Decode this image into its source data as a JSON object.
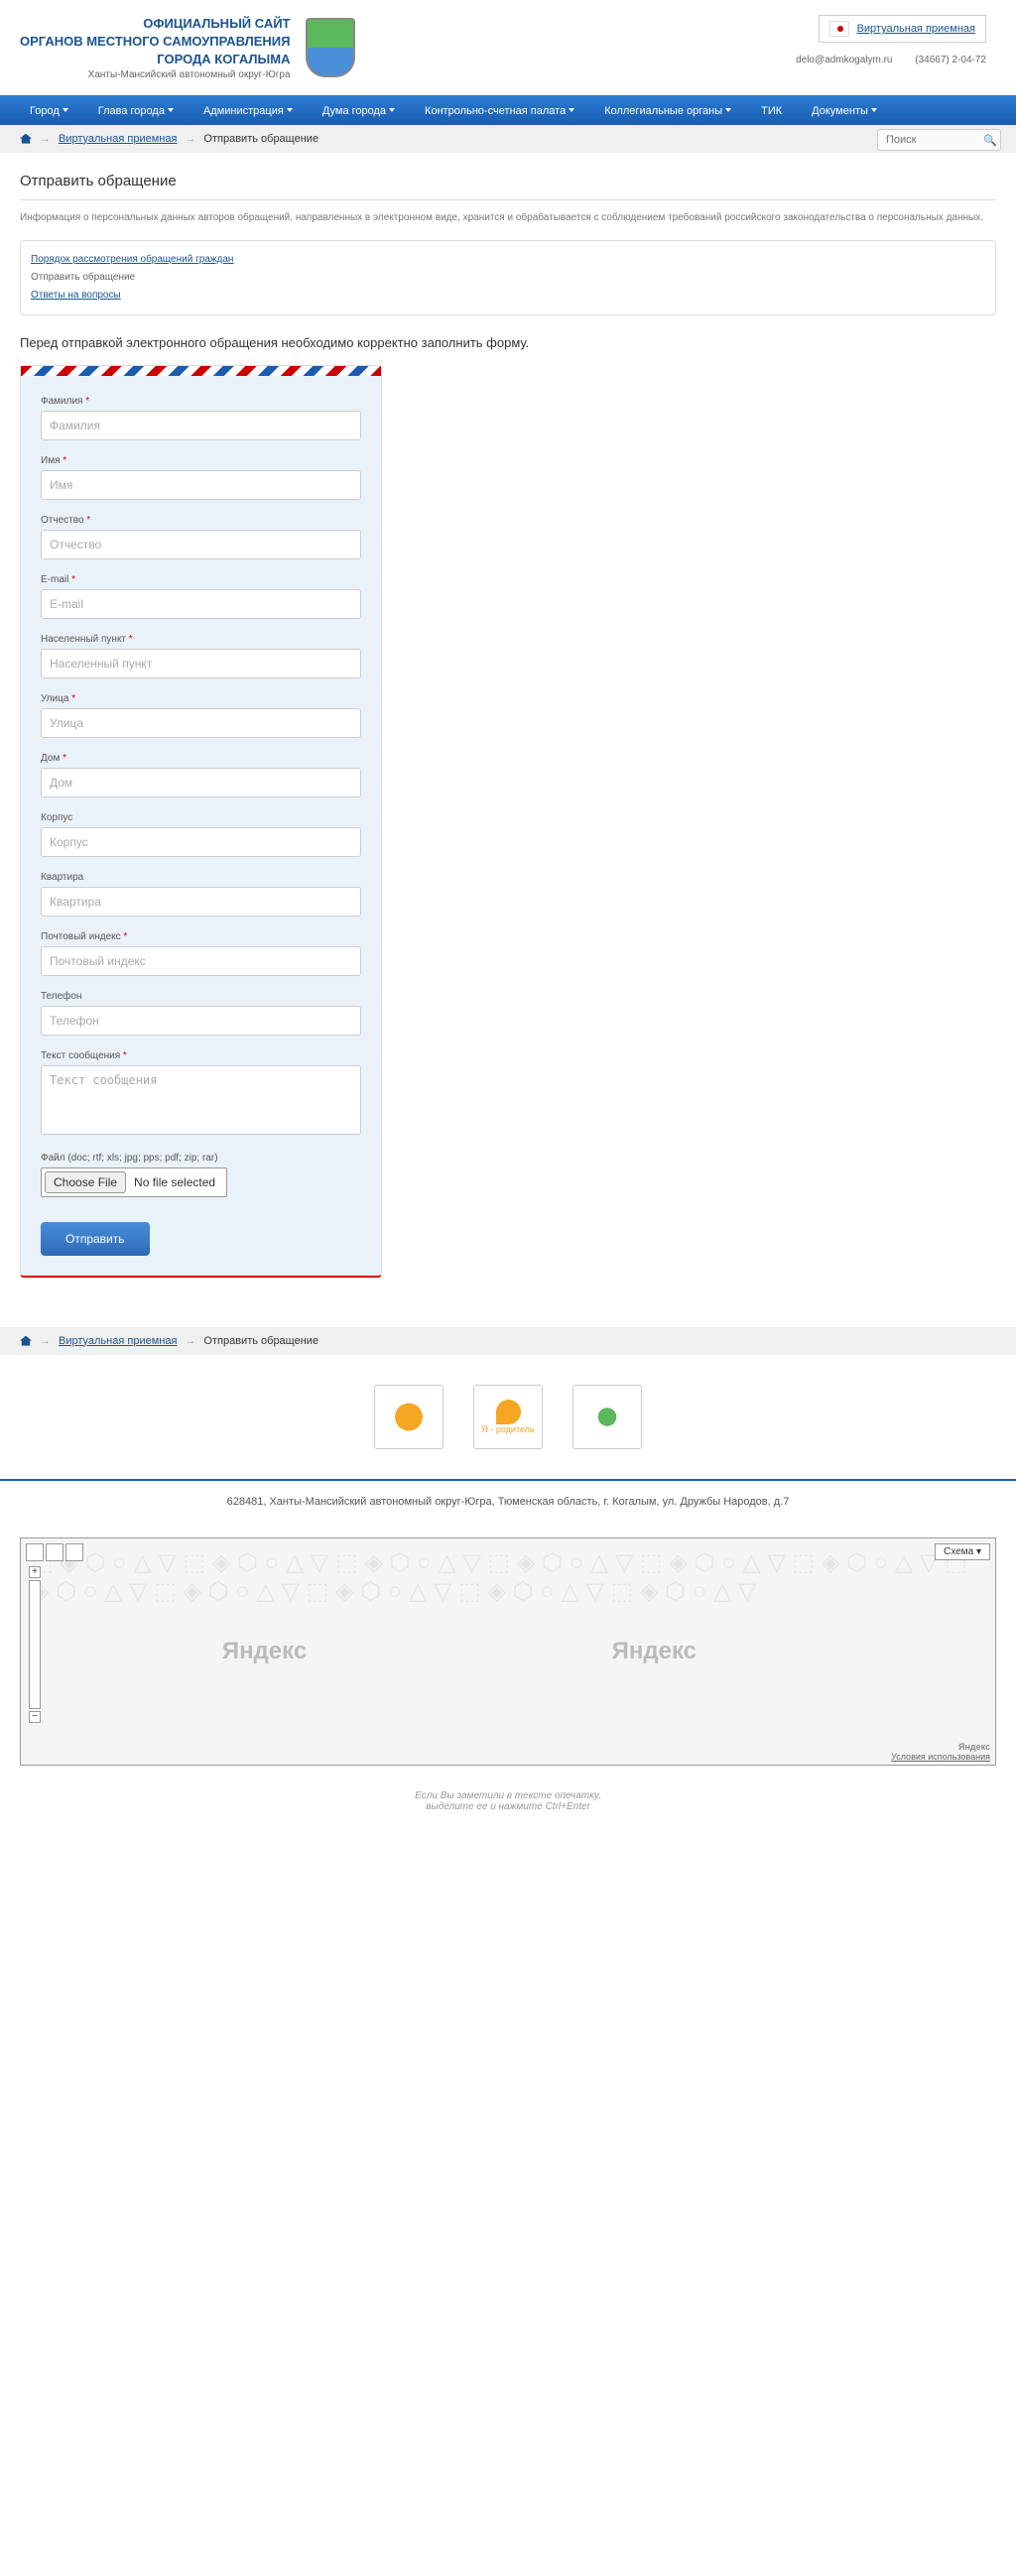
{
  "header": {
    "title_l1": "ОФИЦИАЛЬНЫЙ САЙТ",
    "title_l2": "ОРГАНОВ МЕСТНОГО САМОУПРАВЛЕНИЯ",
    "title_l3": "ГОРОДА КОГАЛЫМА",
    "subtitle": "Ханты-Мансийский автономный округ-Югра",
    "virtual_link": "Виртуальная приемная",
    "email": "delo@admkogalym.ru",
    "phone": "(34667) 2-04-72"
  },
  "nav": {
    "items": [
      "Город",
      "Глава города",
      "Администрация",
      "Дума города",
      "Контрольно-счетная палата",
      "Коллегиальные органы",
      "ТИК",
      "Документы"
    ],
    "has_caret": [
      true,
      true,
      true,
      true,
      true,
      true,
      false,
      true
    ]
  },
  "breadcrumb": {
    "link1": "Виртуальная приемная",
    "current": "Отправить обращение"
  },
  "search": {
    "placeholder": "Поиск"
  },
  "page": {
    "title": "Отправить обращение",
    "info": "Информация о персональных данных авторов обращений, направленных в электронном виде, хранится и обрабатывается с соблюдением требований российского законодательства о персональных данных.",
    "links": {
      "l1": "Порядок рассмотрения обращений граждан",
      "l2": "Отправить обращение",
      "l3": "Ответы на вопросы"
    },
    "form_intro": "Перед отправкой электронного обращения необходимо корректно заполнить форму."
  },
  "form": {
    "fields": [
      {
        "label": "Фамилия",
        "req": true,
        "ph": "Фамилия"
      },
      {
        "label": "Имя",
        "req": true,
        "ph": "Имя"
      },
      {
        "label": "Отчество",
        "req": true,
        "ph": "Отчество"
      },
      {
        "label": "E-mail",
        "req": true,
        "ph": "E-mail"
      },
      {
        "label": "Населенный пункт",
        "req": true,
        "ph": "Населенный пункт"
      },
      {
        "label": "Улица",
        "req": true,
        "ph": "Улица"
      },
      {
        "label": "Дом",
        "req": true,
        "ph": "Дом"
      },
      {
        "label": "Корпус",
        "req": false,
        "ph": "Корпус"
      },
      {
        "label": "Квартира",
        "req": false,
        "ph": "Квартира"
      },
      {
        "label": "Почтовый индекс",
        "req": true,
        "ph": "Почтовый индекс"
      },
      {
        "label": "Телефон",
        "req": false,
        "ph": "Телефон"
      }
    ],
    "message": {
      "label": "Текст сообщения",
      "req": true,
      "ph": "Текст сообщения"
    },
    "file": {
      "label": "Файл (doc; rtf; xls; jpg; pps; pdf; zip; rar)",
      "btn": "Choose File",
      "none": "No file selected"
    },
    "submit": "Отправить"
  },
  "footer": {
    "address": "628481, Ханты-Мансийский автономный округ-Югра, Тюменская область, г. Когалым, ул. Дружбы Народов, д.7",
    "scheme": "Схема ▾",
    "yandex": "Яндекс",
    "terms": "Условия использования",
    "typo_l1": "Если Вы заметили в тексте опечатку,",
    "typo_l2": "выделите ее и нажмите Ctrl+Enter"
  },
  "banners": {
    "b2_text": "Я - родитель"
  }
}
